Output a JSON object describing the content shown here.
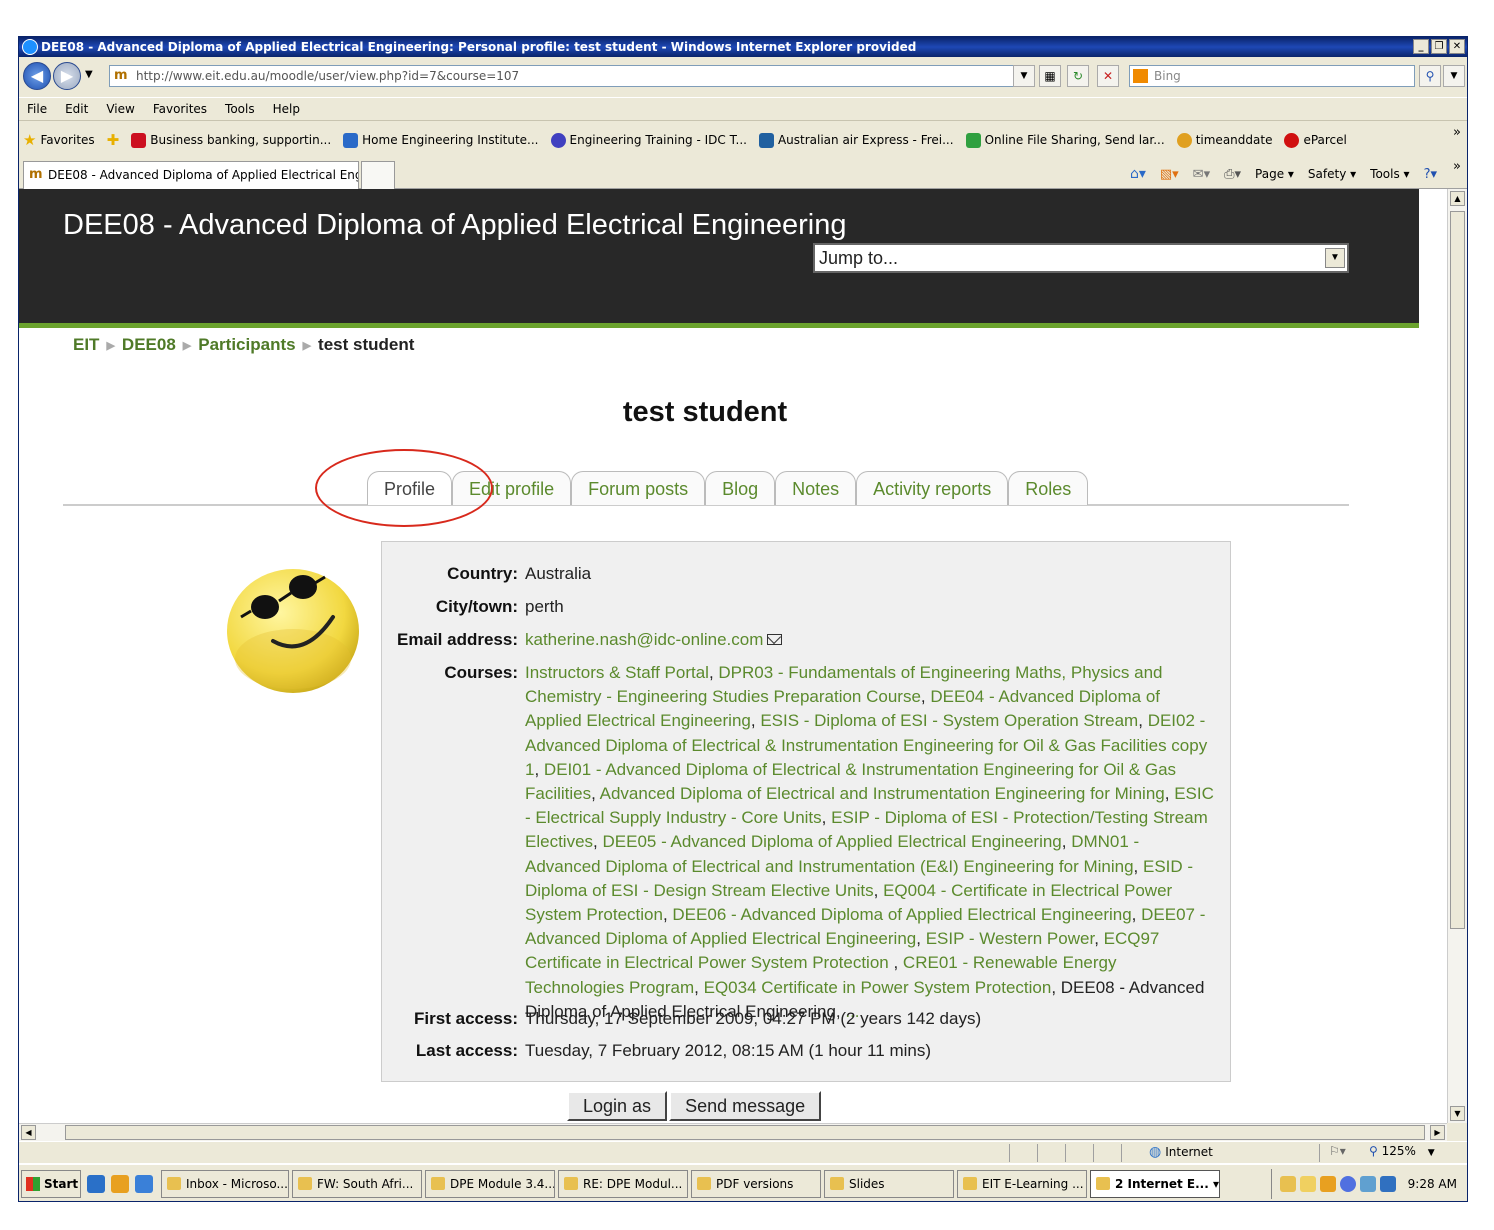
{
  "window": {
    "title": "DEE08 - Advanced Diploma of Applied Electrical Engineering: Personal profile: test student - Windows Internet Explorer provided",
    "buttons": [
      "_",
      "❐",
      "✕"
    ]
  },
  "address_bar": {
    "url": "http://www.eit.edu.au/moodle/user/view.php?id=7&course=107",
    "search_placeholder": "Bing"
  },
  "menu": [
    "File",
    "Edit",
    "View",
    "Favorites",
    "Tools",
    "Help"
  ],
  "favorites_bar": {
    "label": "Favorites",
    "items": [
      {
        "label": "Business banking, supportin...",
        "color": "#cc1020"
      },
      {
        "label": "Home  Engineering Institute...",
        "color": "#2a6ac8"
      },
      {
        "label": "Engineering Training - IDC T...",
        "color": "#4040c0"
      },
      {
        "label": "Australian air Express - Frei...",
        "color": "#2060a0"
      },
      {
        "label": "Online File Sharing, Send lar...",
        "color": "#30a040"
      },
      {
        "label": "timeanddate",
        "color": "#e0a020"
      },
      {
        "label": "eParcel",
        "color": "#d01010"
      }
    ],
    "more": "»"
  },
  "browser_tab": {
    "label": "DEE08 - Advanced Diploma of Applied Electrical Engin..."
  },
  "command_bar": [
    "Page ▾",
    "Safety ▾",
    "Tools ▾"
  ],
  "page": {
    "site_title": "DEE08 - Advanced Diploma of Applied Electrical Engineering",
    "jump_to": "Jump to...",
    "breadcrumb": [
      "EIT",
      "DEE08",
      "Participants",
      "test student"
    ],
    "title": "test student",
    "tabs": [
      "Profile",
      "Edit profile",
      "Forum posts",
      "Blog",
      "Notes",
      "Activity reports",
      "Roles"
    ],
    "profile": {
      "country_label": "Country:",
      "country": "Australia",
      "city_label": "City/town:",
      "city": "perth",
      "email_label": "Email address:",
      "email": "katherine.nash@idc-online.com",
      "courses_label": "Courses:",
      "courses": [
        "Instructors & Staff Portal",
        "DPR03 - Fundamentals of Engineering Maths, Physics and Chemistry - Engineering Studies Preparation Course",
        "DEE04 - Advanced Diploma of Applied Electrical Engineering",
        "ESIS - Diploma of ESI - System Operation Stream",
        "DEI02 - Advanced Diploma of Electrical & Instrumentation Engineering for Oil & Gas Facilities copy 1",
        "DEI01 - Advanced Diploma of Electrical & Instrumentation Engineering for Oil & Gas Facilities",
        "Advanced Diploma of Electrical and Instrumentation Engineering for Mining",
        "ESIC - Electrical Supply Industry - Core Units",
        "ESIP - Diploma of ESI - Protection/Testing Stream Electives",
        "DEE05 - Advanced Diploma of Applied Electrical Engineering",
        "DMN01 - Advanced Diploma of Electrical and Instrumentation (E&I) Engineering for Mining",
        "ESID - Diploma of ESI - Design Stream Elective Units",
        "EQ004 - Certificate in Electrical Power System Protection",
        "DEE06 - Advanced Diploma of Applied Electrical Engineering",
        "DEE07 - Advanced Diploma of Applied Electrical Engineering",
        "ESIP - Western Power",
        "ECQ97 Certificate in Electrical Power System Protection ",
        "CRE01 - Renewable Energy Technologies Program",
        "EQ034 Certificate in Power System Protection"
      ],
      "current_course": "DEE08 - Advanced Diploma of Applied Electrical Engineering",
      "courses_more": "...",
      "first_access_label": "First access:",
      "first_access": "Thursday, 17 September 2009, 04:27 PM  (2 years 142 days)",
      "last_access_label": "Last access:",
      "last_access": "Tuesday, 7 February 2012, 08:15 AM  (1 hour 11 mins)"
    },
    "buttons": {
      "login_as": "Login as",
      "send_message": "Send message"
    }
  },
  "status_bar": {
    "zone": "Internet",
    "zoom": "125%"
  },
  "taskbar": {
    "start": "Start",
    "tasks": [
      {
        "label": "Inbox - Microso...",
        "width": 128
      },
      {
        "label": "FW: South Afri...",
        "width": 130
      },
      {
        "label": "DPE Module 3.4...",
        "width": 130
      },
      {
        "label": "RE: DPE Modul...",
        "width": 130
      },
      {
        "label": "PDF versions",
        "width": 130
      },
      {
        "label": "Slides",
        "width": 130
      },
      {
        "label": "EIT E-Learning ...",
        "width": 130
      },
      {
        "label": "2 Internet E... ▾",
        "width": 130,
        "active": true
      }
    ],
    "clock": "9:28 AM"
  }
}
